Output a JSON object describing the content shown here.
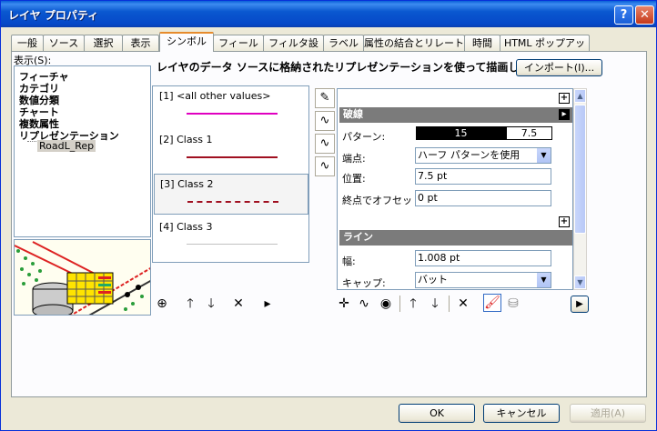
{
  "window": {
    "title": "レイヤ プロパティ",
    "help_btn": "?",
    "close_btn": "✕"
  },
  "tabs": [
    "一般",
    "ソース",
    "選択",
    "表示",
    "シンボル",
    "フィールド",
    "フィルタ設定",
    "ラベル",
    "属性の結合とリレート",
    "時間",
    "HTML ポップアップ"
  ],
  "active_tab": "シンボル",
  "show": {
    "label": "表示(S):",
    "items": [
      "フィーチャ",
      "カテゴリ",
      "数値分類",
      "チャート",
      "複数属性",
      "リプレゼンテーション"
    ],
    "child": "RoadL_Rep"
  },
  "description": "レイヤのデータ ソースに格納されたリプレゼンテーションを使って描画します。",
  "import_button": "インポート(I)...",
  "classes": [
    {
      "label": "[1] <all other values>",
      "color": "#e000c0",
      "style": "solid"
    },
    {
      "label": "[2] Class 1",
      "color": "#a01020",
      "style": "solid"
    },
    {
      "label": "[3] Class 2",
      "color": "#a01020",
      "style": "dashed"
    },
    {
      "label": "[4] Class 3",
      "color": "#c0c0c0",
      "style": "solid"
    }
  ],
  "properties": {
    "section1": "破線",
    "pattern_label": "パターン:",
    "pattern_values": [
      "15",
      "7.5"
    ],
    "endpoint_label": "端点:",
    "endpoint_value": "ハーフ パターンを使用",
    "position_label": "位置:",
    "position_value": "7.5 pt",
    "offset_label": "終点でオフセット:",
    "offset_value": "0 pt",
    "section2": "ライン",
    "width_label": "幅:",
    "width_value": "1.008 pt",
    "cap_label": "キャップ:",
    "cap_value": "バット"
  },
  "buttons": {
    "ok": "OK",
    "cancel": "キャンセル",
    "apply": "適用(A)"
  }
}
